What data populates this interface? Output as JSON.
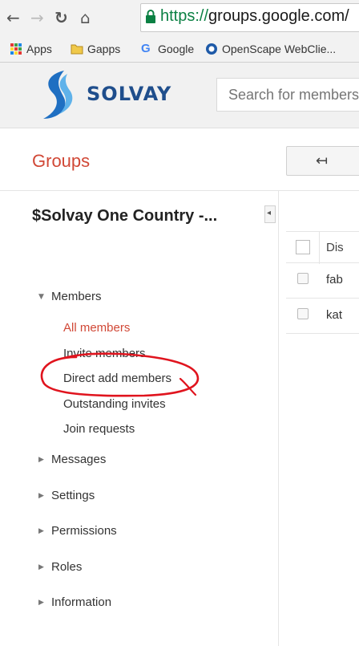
{
  "browser": {
    "url_scheme": "https://",
    "url_host": "groups.google.com/",
    "bookmarks": [
      {
        "label": "Apps",
        "icon": "apps-grid-icon"
      },
      {
        "label": "Gapps",
        "icon": "folder-icon"
      },
      {
        "label": "Google",
        "icon": "google-g-icon"
      },
      {
        "label": "OpenScape WebClie...",
        "icon": "openscape-icon"
      }
    ]
  },
  "header": {
    "logo_text": "SOLVAY",
    "search_placeholder": "Search for members"
  },
  "groups": {
    "title": "Groups",
    "back_icon": "back-arrow-icon"
  },
  "sidebar": {
    "group_name": "$Solvay One Country -...",
    "sections": [
      {
        "label": "Members",
        "expanded": true
      },
      {
        "label": "Messages",
        "expanded": false
      },
      {
        "label": "Settings",
        "expanded": false
      },
      {
        "label": "Permissions",
        "expanded": false
      },
      {
        "label": "Roles",
        "expanded": false
      },
      {
        "label": "Information",
        "expanded": false
      }
    ],
    "members_items": [
      {
        "label": "All members",
        "active": true
      },
      {
        "label": "Invite members",
        "active": false
      },
      {
        "label": "Direct add members",
        "active": false
      },
      {
        "label": "Outstanding invites",
        "active": false
      },
      {
        "label": "Join requests",
        "active": false
      }
    ]
  },
  "table": {
    "header_label": "Dis",
    "rows": [
      {
        "label": "fab"
      },
      {
        "label": "kat"
      }
    ]
  },
  "colors": {
    "accent_red": "#d14836",
    "logo_blue": "#1f4e8c",
    "annotation_red": "#e0141e"
  }
}
